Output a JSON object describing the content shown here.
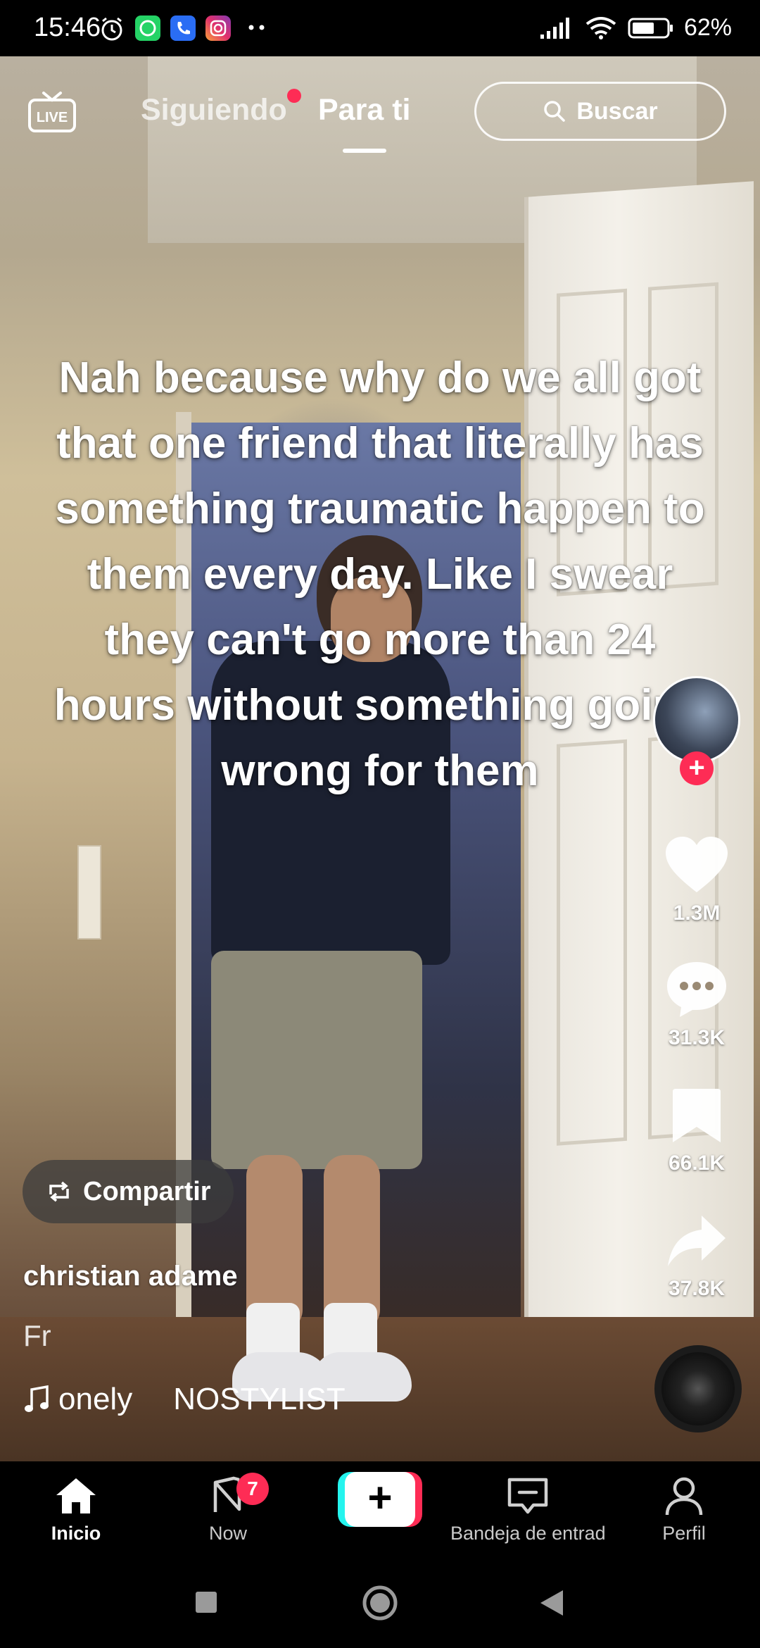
{
  "status_bar": {
    "time": "15:46",
    "battery_percent": "62%"
  },
  "top_nav": {
    "live_label": "LIVE",
    "tab_following": "Siguiendo",
    "tab_for_you": "Para ti",
    "search_label": "Buscar"
  },
  "video": {
    "caption": "Nah because why do we all got that one friend that literally has something traumatic happen to them every day. Like I swear they can't go more than 24 hours without something going wrong for them"
  },
  "actions": {
    "likes": "1.3M",
    "comments": "31.3K",
    "saves": "66.1K",
    "shares": "37.8K"
  },
  "overlay": {
    "share_label": "Compartir",
    "username": "christian adame",
    "description": "Fr",
    "sound_a": "onely",
    "sound_b": "NOSTYLIST"
  },
  "bottom_nav": {
    "home": "Inicio",
    "now": "Now",
    "now_badge": "7",
    "create": "+",
    "inbox": "Bandeja de entrada",
    "profile": "Perfil"
  },
  "colors": {
    "accent_pink": "#fe2c55",
    "accent_cyan": "#25f4ee"
  }
}
